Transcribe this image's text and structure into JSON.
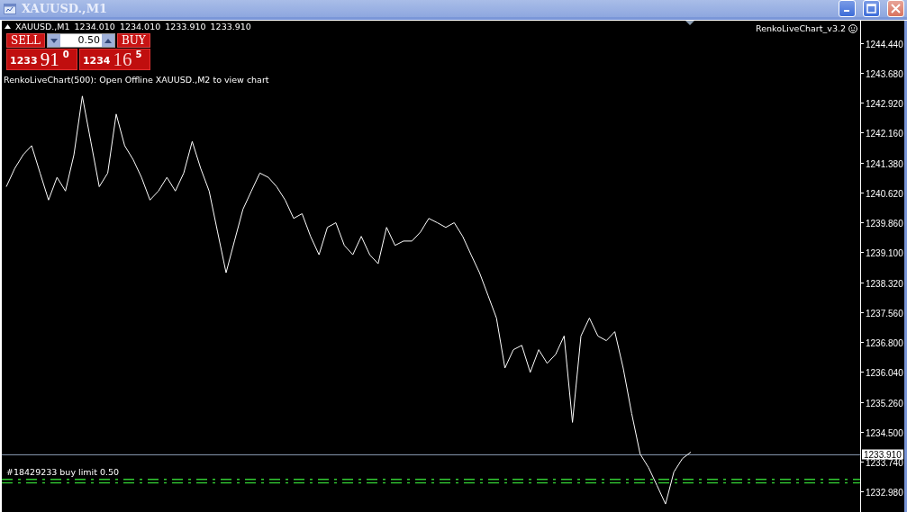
{
  "window": {
    "title": "XAUUSD.,M1"
  },
  "chart": {
    "header": {
      "symbol": "XAUUSD.,M1",
      "ohlc": [
        "1234.010",
        "1234.010",
        "1233.910",
        "1233.910"
      ]
    },
    "trade_panel": {
      "sell_label": "SELL",
      "buy_label": "BUY",
      "lots": "0.50",
      "sell_price_big": "1233",
      "sell_price_main": "91",
      "sell_price_small": "0",
      "buy_price_big": "1234",
      "buy_price_main": "16",
      "buy_price_small": "5"
    },
    "indicator_message": "RenkoLiveChart(500): Open Offline XAUUSD.,M2 to view chart",
    "expert_name": "RenkoLiveChart_v3.2",
    "chart_data": {
      "type": "line",
      "ylim": [
        1232.445,
        1245.02
      ],
      "ref_lines": [
        {
          "axis": "y",
          "value": 1233.91,
          "color": "#8fa0b8",
          "label": "1233.910"
        },
        {
          "axis": "y",
          "value": 1233.28,
          "color": "#33cc33",
          "label": "#18429233 buy limit 0.50"
        },
        {
          "axis": "y",
          "value": 1233.19,
          "color": "#33cc33"
        }
      ],
      "yticks": [
        {
          "value": 1244.44,
          "label": "1244.440"
        },
        {
          "value": 1243.68,
          "label": "1243.680"
        },
        {
          "value": 1242.92,
          "label": "1242.920"
        },
        {
          "value": 1242.16,
          "label": "1242.160"
        },
        {
          "value": 1241.38,
          "label": "1241.380"
        },
        {
          "value": 1240.62,
          "label": "1240.620"
        },
        {
          "value": 1239.86,
          "label": "1239.860"
        },
        {
          "value": 1239.1,
          "label": "1239.100"
        },
        {
          "value": 1238.32,
          "label": "1238.320"
        },
        {
          "value": 1237.56,
          "label": "1237.560"
        },
        {
          "value": 1236.8,
          "label": "1236.800"
        },
        {
          "value": 1236.04,
          "label": "1236.040"
        },
        {
          "value": 1235.26,
          "label": "1235.260"
        },
        {
          "value": 1234.5,
          "label": "1234.500"
        },
        {
          "value": 1233.74,
          "label": "1233.740"
        },
        {
          "value": 1232.98,
          "label": "1232.980"
        }
      ],
      "series": [
        {
          "color": "#ffffff",
          "values": [
            1240.77,
            1241.24,
            1241.59,
            1241.82,
            1241.12,
            1240.43,
            1241.01,
            1240.66,
            1241.59,
            1243.09,
            1241.93,
            1240.77,
            1241.12,
            1242.63,
            1241.82,
            1241.47,
            1241.01,
            1240.43,
            1240.66,
            1241.01,
            1240.66,
            1241.12,
            1241.93,
            1241.24,
            1240.66,
            1239.61,
            1238.57,
            1239.38,
            1240.19,
            1240.66,
            1241.12,
            1241.01,
            1240.77,
            1240.43,
            1239.96,
            1240.08,
            1239.5,
            1239.03,
            1239.73,
            1239.85,
            1239.27,
            1239.03,
            1239.5,
            1239.03,
            1238.8,
            1239.73,
            1239.27,
            1239.38,
            1239.38,
            1239.61,
            1239.96,
            1239.85,
            1239.73,
            1239.85,
            1239.5,
            1239.03,
            1238.57,
            1237.99,
            1237.41,
            1236.13,
            1236.6,
            1236.71,
            1236.02,
            1236.6,
            1236.25,
            1236.48,
            1236.95,
            1234.74,
            1236.95,
            1237.41,
            1236.95,
            1236.83,
            1237.06,
            1236.13,
            1234.97,
            1233.93,
            1233.58,
            1233.12,
            1232.65,
            1233.47,
            1233.81,
            1233.98
          ]
        }
      ]
    }
  }
}
